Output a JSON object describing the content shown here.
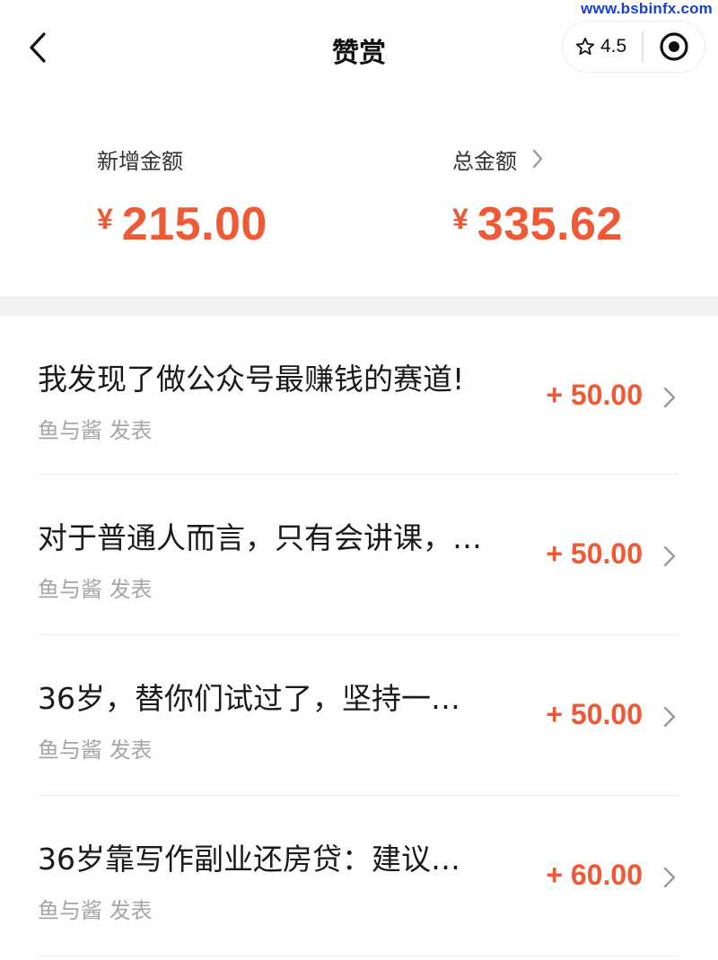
{
  "watermark": "www.bsbinfx.com",
  "nav": {
    "title": "赞赏",
    "rating": "4.5"
  },
  "summary": {
    "new_label": "新增金额",
    "new_currency": "¥",
    "new_amount": "215.00",
    "total_label": "总金额",
    "total_currency": "¥",
    "total_amount": "335.62"
  },
  "items": [
    {
      "title": "我发现了做公众号最赚钱的赛道!",
      "meta": "鱼与酱 发表",
      "amount": "+ 50.00"
    },
    {
      "title": "对于普通人而言，只有会讲课，…",
      "meta": "鱼与酱 发表",
      "amount": "+ 50.00"
    },
    {
      "title": "36岁，替你们试过了，坚持一…",
      "meta": "鱼与酱 发表",
      "amount": "+ 50.00"
    },
    {
      "title": "36岁靠写作副业还房贷：建议…",
      "meta": "鱼与酱 发表",
      "amount": "+ 60.00"
    }
  ],
  "colors": {
    "accent": "#ee5a36",
    "muted": "#a6a6a6",
    "divider": "#ececec"
  },
  "icons": {
    "back": "chevron-left-icon",
    "rating": "star-icon",
    "capsule": "target-icon",
    "row": "chevron-right-icon"
  }
}
